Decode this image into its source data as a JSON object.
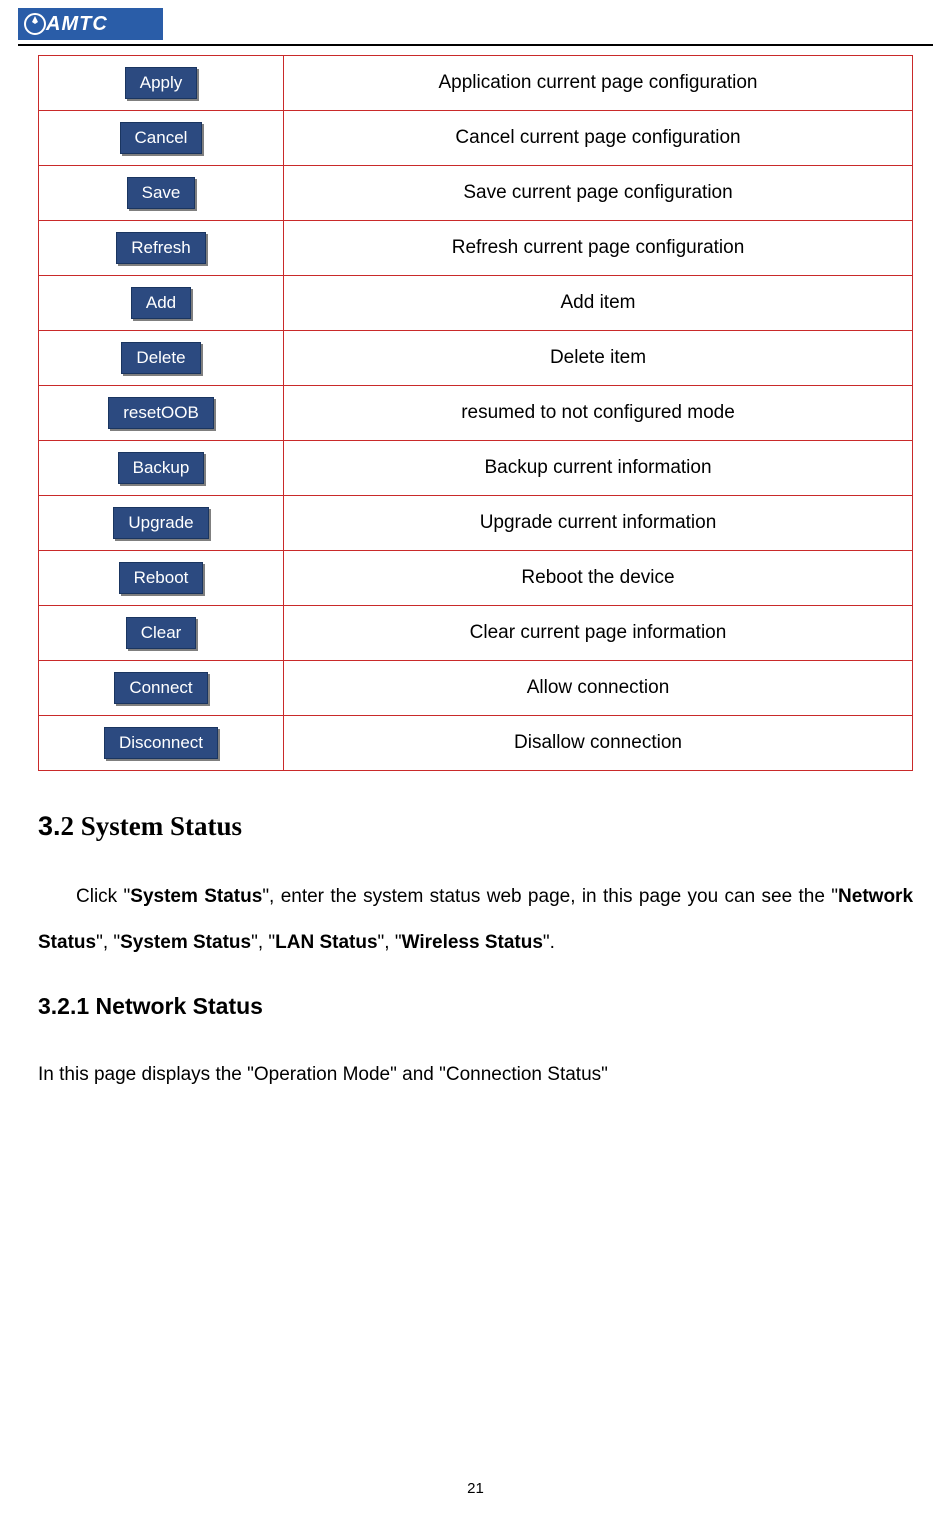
{
  "logo": "AMTC",
  "table": {
    "rows": [
      {
        "button": "Apply",
        "desc": "Application current page configuration"
      },
      {
        "button": "Cancel",
        "desc": "Cancel current page configuration"
      },
      {
        "button": "Save",
        "desc": "Save current page configuration"
      },
      {
        "button": "Refresh",
        "desc": "Refresh current page configuration"
      },
      {
        "button": "Add",
        "desc": "Add item"
      },
      {
        "button": "Delete",
        "desc": "Delete item"
      },
      {
        "button": "resetOOB",
        "desc": "resumed to not configured mode"
      },
      {
        "button": "Backup",
        "desc": "Backup current information"
      },
      {
        "button": "Upgrade",
        "desc": "Upgrade current information"
      },
      {
        "button": "Reboot",
        "desc": "Reboot the device"
      },
      {
        "button": "Clear",
        "desc": "Clear current page information"
      },
      {
        "button": "Connect",
        "desc": "Allow connection"
      },
      {
        "button": "Disconnect",
        "desc": "Disallow connection"
      }
    ]
  },
  "heading_num": "3.",
  "heading_num2": "2",
  "heading_text": " System Status",
  "para_parts": {
    "p1": "Click \"",
    "p2": "System Status",
    "p3": "\", enter the system status web page, in this page you can see the \"",
    "p4": "Network Status",
    "p5": "\", \"",
    "p6": "System Status",
    "p7": "\", \"",
    "p8": "LAN Status",
    "p9": "\", \"",
    "p10": "Wireless Status",
    "p11": "\"."
  },
  "subheading": "3.2.1 Network Status",
  "para2": "In this page displays the \"Operation Mode\" and \"Connection Status\"",
  "page_number": "21"
}
